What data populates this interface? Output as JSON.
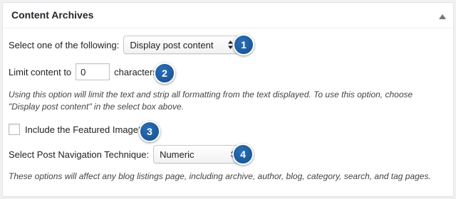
{
  "panel": {
    "title": "Content Archives",
    "collapse_icon": "triangle-up-icon"
  },
  "content_select": {
    "label": "Select one of the following:",
    "selected": "Display post content"
  },
  "limit": {
    "label_before": "Limit content to",
    "value": "0",
    "label_after": "characters"
  },
  "help_limit": "Using this option will limit the text and strip all formatting from the text displayed. To use this option, choose \"Display post content\" in the select box above.",
  "featured_image": {
    "label": "Include the Featured Image?",
    "checked": false
  },
  "navigation": {
    "label": "Select Post Navigation Technique:",
    "selected": "Numeric"
  },
  "help_listings": "These options will affect any blog listings page, including archive, author, blog, category, search, and tag pages.",
  "badges": [
    "1",
    "2",
    "3",
    "4"
  ],
  "colors": {
    "badge": "#1a5fa3",
    "panel_bg": "#ffffff",
    "page_bg": "#f1f1f1"
  }
}
